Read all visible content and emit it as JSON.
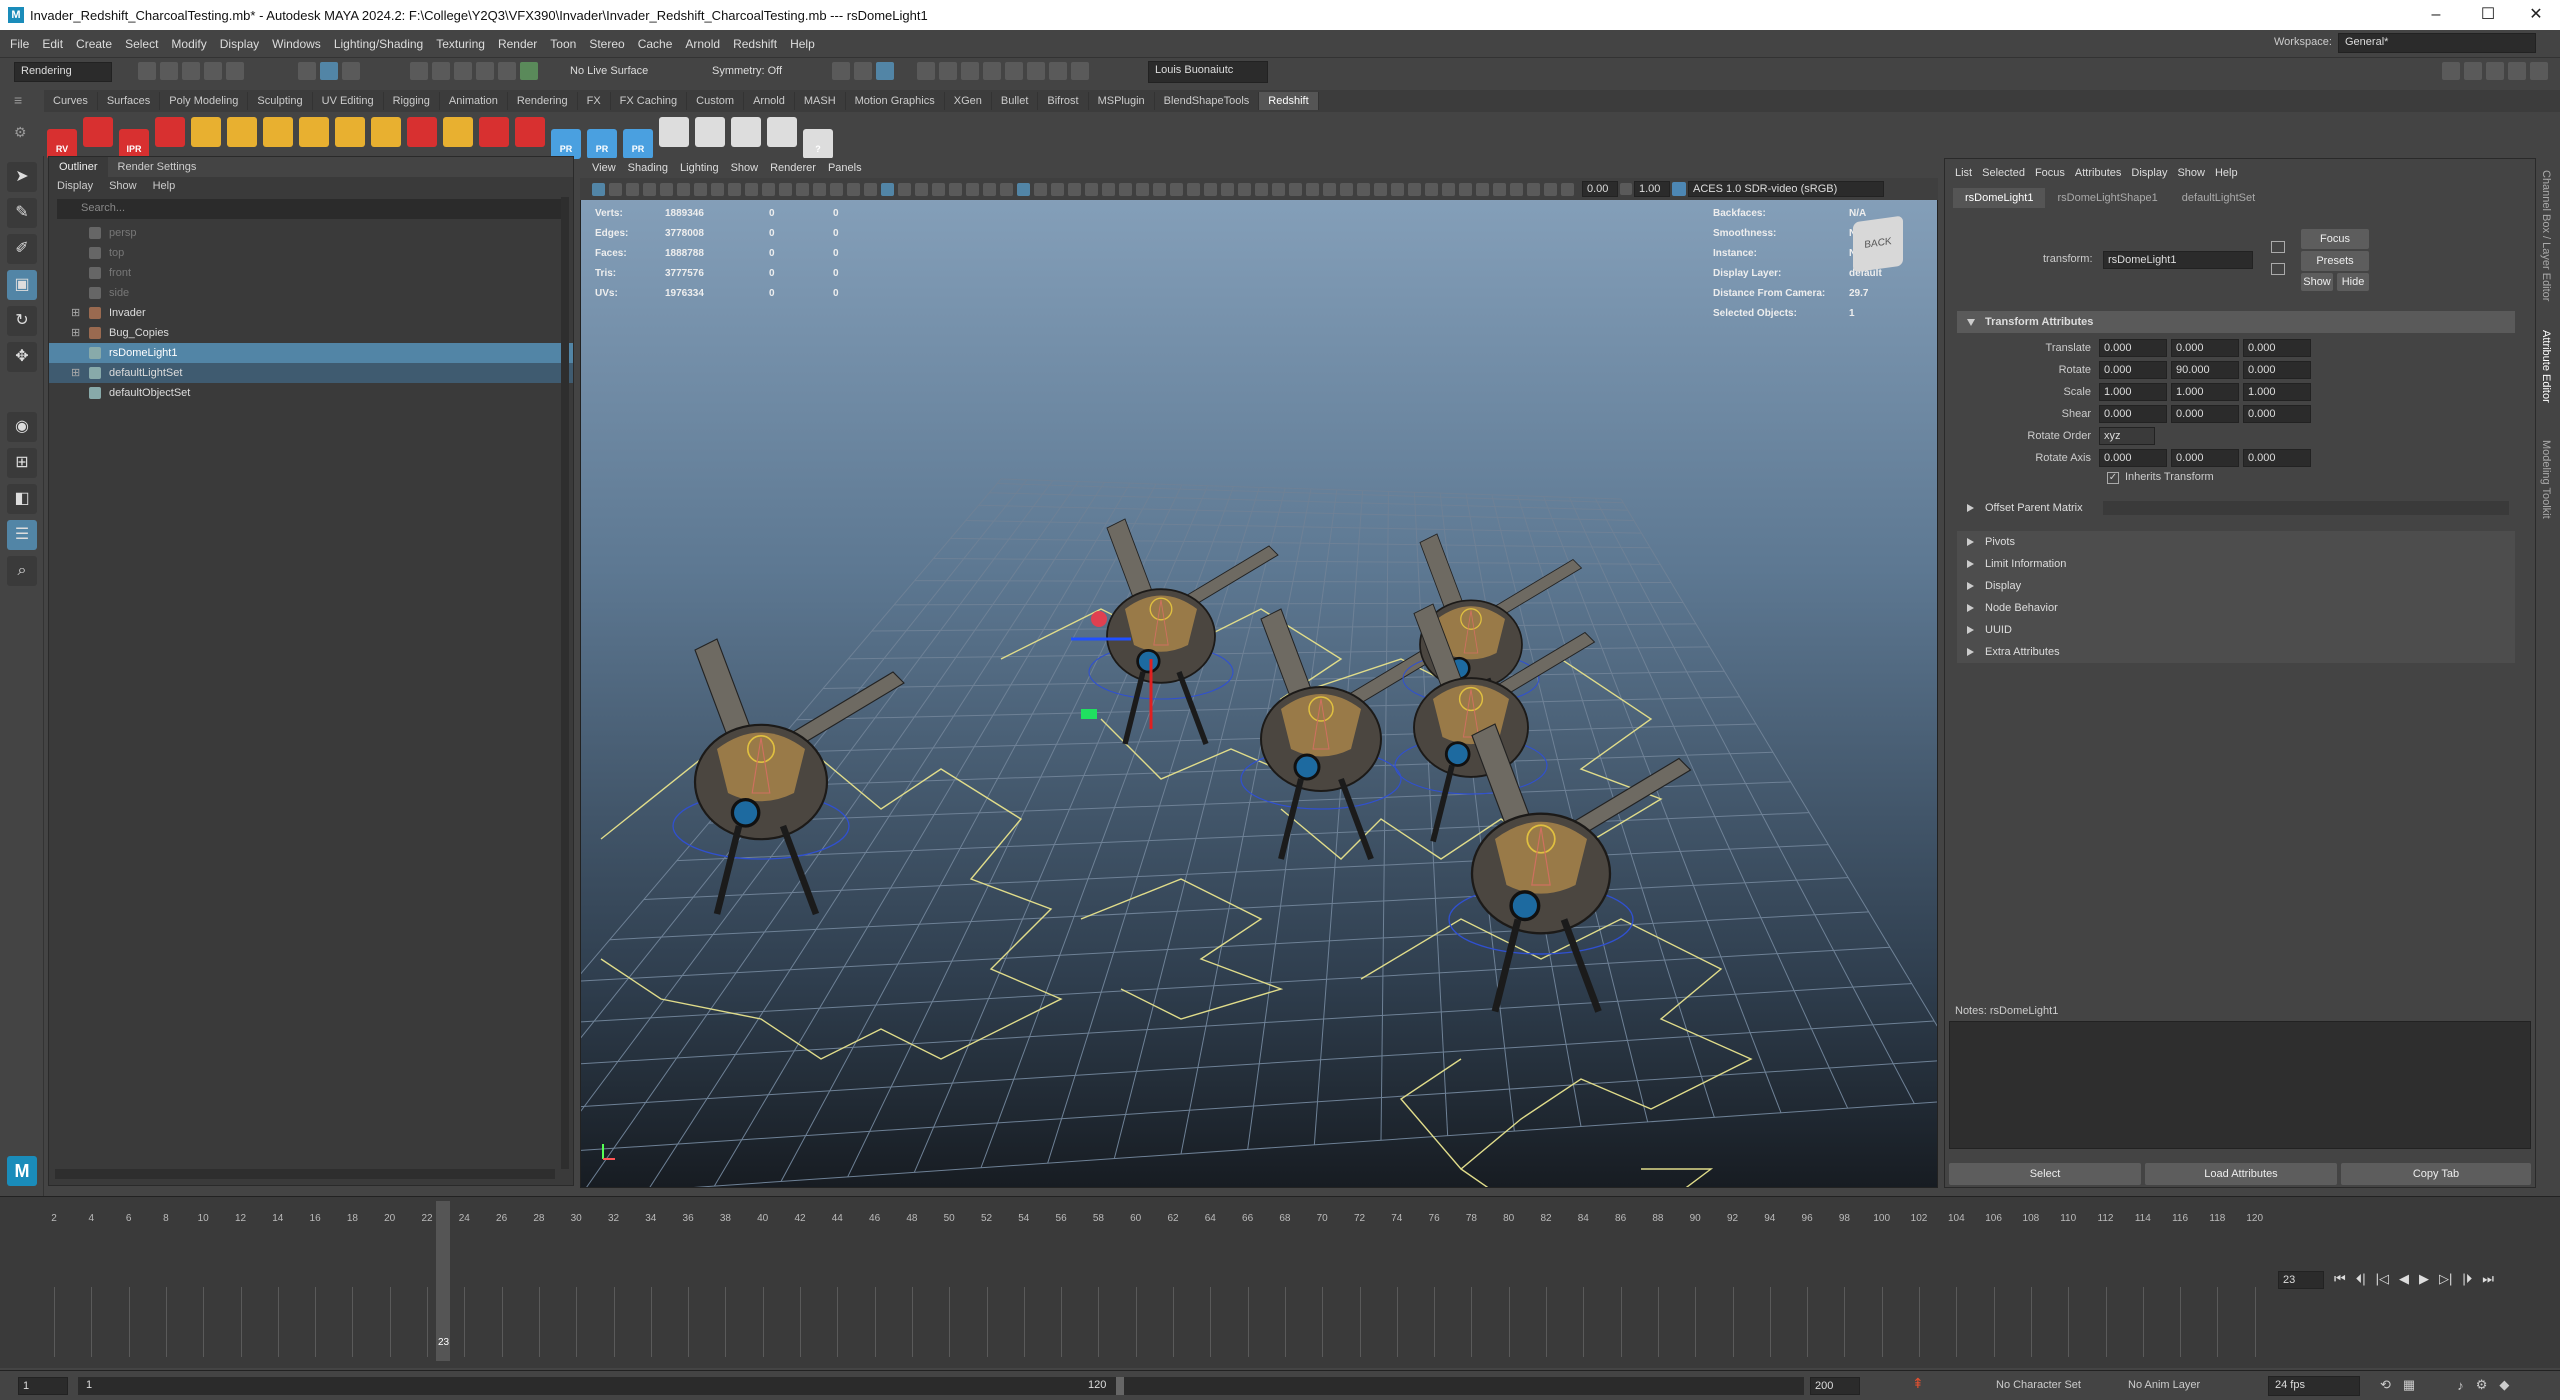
{
  "window": {
    "title": "Invader_Redshift_CharcoalTesting.mb* - Autodesk MAYA 2024.2: F:\\College\\Y2Q3\\VFX390\\Invader\\Invader_Redshift_CharcoalTesting.mb   ---   rsDomeLight1",
    "logo": "M"
  },
  "menubar": {
    "items": [
      "File",
      "Edit",
      "Create",
      "Select",
      "Modify",
      "Display",
      "Windows",
      "Lighting/Shading",
      "Texturing",
      "Render",
      "Toon",
      "Stereo",
      "Cache",
      "Arnold",
      "Redshift",
      "Help"
    ],
    "workspace_label": "Workspace:",
    "workspace_value": "General*"
  },
  "statusline": {
    "menuset": "Rendering",
    "live_surface": "No Live Surface",
    "symmetry": "Symmetry: Off",
    "user": "Louis Buonaiutc"
  },
  "shelf": {
    "tabs": [
      "Curves",
      "Surfaces",
      "Poly Modeling",
      "Sculpting",
      "UV Editing",
      "Rigging",
      "Animation",
      "Rendering",
      "FX",
      "FX Caching",
      "Custom",
      "Arnold",
      "MASH",
      "Motion Graphics",
      "XGen",
      "Bullet",
      "Bifrost",
      "MSPlugin",
      "BlendShapeTools",
      "Redshift"
    ],
    "active_tab": "Redshift",
    "icon_colors": [
      "#d83030",
      "#d83030",
      "#d83030",
      "#d83030",
      "#e8b030",
      "#e8b030",
      "#e8b030",
      "#e8b030",
      "#e8b030",
      "#e8b030",
      "#d83030",
      "#e8b030",
      "#d83030",
      "#d83030",
      "#4aa0e0",
      "#4aa0e0",
      "#4aa0e0",
      "#dddddd",
      "#dddddd",
      "#dddddd",
      "#dddddd",
      "#dddddd"
    ],
    "icon_labels": [
      "RV",
      "",
      "IPR",
      "",
      "",
      "",
      "",
      "",
      "",
      "",
      "",
      "",
      "",
      "",
      "PR",
      "PR",
      "PR",
      "",
      "",
      "",
      "",
      "?"
    ]
  },
  "outliner": {
    "tabs": [
      "Outliner",
      "Render Settings"
    ],
    "menu": [
      "Display",
      "Show",
      "Help"
    ],
    "search_placeholder": "Search...",
    "items": [
      {
        "label": "persp",
        "dim": true
      },
      {
        "label": "top",
        "dim": true
      },
      {
        "label": "front",
        "dim": true
      },
      {
        "label": "side",
        "dim": true
      },
      {
        "label": "Invader",
        "dim": false
      },
      {
        "label": "Bug_Copies",
        "dim": false
      },
      {
        "label": "rsDomeLight1",
        "dim": false
      },
      {
        "label": "defaultLightSet",
        "dim": false
      },
      {
        "label": "defaultObjectSet",
        "dim": false
      }
    ]
  },
  "viewport": {
    "menu": [
      "View",
      "Shading",
      "Lighting",
      "Show",
      "Renderer",
      "Panels"
    ],
    "exposure": "0.00",
    "gamma": "1.00",
    "color_space": "ACES 1.0 SDR-video (sRGB)",
    "hud_left": [
      {
        "label": "Verts:",
        "v1": "1889346",
        "v2": "0",
        "v3": "0"
      },
      {
        "label": "Edges:",
        "v1": "3778008",
        "v2": "0",
        "v3": "0"
      },
      {
        "label": "Faces:",
        "v1": "1888788",
        "v2": "0",
        "v3": "0"
      },
      {
        "label": "Tris:",
        "v1": "3777576",
        "v2": "0",
        "v3": "0"
      },
      {
        "label": "UVs:",
        "v1": "1976334",
        "v2": "0",
        "v3": "0"
      }
    ],
    "hud_right": [
      {
        "label": "Backfaces:",
        "value": "N/A"
      },
      {
        "label": "Smoothness:",
        "value": "N/A"
      },
      {
        "label": "Instance:",
        "value": "No"
      },
      {
        "label": "Display Layer:",
        "value": "default"
      },
      {
        "label": "Distance From Camera:",
        "value": "29.7"
      },
      {
        "label": "Selected Objects:",
        "value": "1"
      }
    ],
    "cube_label": "BACK"
  },
  "attribute_editor": {
    "menu": [
      "List",
      "Selected",
      "Focus",
      "Attributes",
      "Display",
      "Show",
      "Help"
    ],
    "tabs": [
      "rsDomeLight1",
      "rsDomeLightShape1",
      "defaultLightSet"
    ],
    "transform_label": "transform:",
    "transform_value": "rsDomeLight1",
    "buttons": {
      "focus": "Focus",
      "presets": "Presets",
      "show": "Show",
      "hide": "Hide"
    },
    "section_title": "Transform Attributes",
    "translate": {
      "label": "Translate",
      "x": "0.000",
      "y": "0.000",
      "z": "0.000"
    },
    "rotate": {
      "label": "Rotate",
      "x": "0.000",
      "y": "90.000",
      "z": "0.000"
    },
    "scale": {
      "label": "Scale",
      "x": "1.000",
      "y": "1.000",
      "z": "1.000"
    },
    "shear": {
      "label": "Shear",
      "x": "0.000",
      "y": "0.000",
      "z": "0.000"
    },
    "rotate_order": {
      "label": "Rotate Order",
      "value": "xyz"
    },
    "rotate_axis": {
      "label": "Rotate Axis",
      "x": "0.000",
      "y": "0.000",
      "z": "0.000"
    },
    "inherits_label": "Inherits Transform",
    "offset_parent": "Offset Parent Matrix",
    "sections": [
      "Pivots",
      "Limit Information",
      "Display",
      "Node Behavior",
      "UUID",
      "Extra Attributes"
    ],
    "notes_label": "Notes:  rsDomeLight1",
    "bottom_buttons": [
      "Select",
      "Load Attributes",
      "Copy Tab"
    ],
    "side_tabs": [
      "Channel Box / Layer Editor",
      "Attribute Editor",
      "Modeling Toolkit"
    ]
  },
  "timeline": {
    "ticks": [
      "2",
      "4",
      "6",
      "8",
      "10",
      "12",
      "14",
      "16",
      "18",
      "20",
      "22",
      "24",
      "26",
      "28",
      "30",
      "32",
      "34",
      "36",
      "38",
      "40",
      "42",
      "44",
      "46",
      "48",
      "50",
      "52",
      "54",
      "56",
      "58",
      "60",
      "62",
      "64",
      "66",
      "68",
      "70",
      "72",
      "74",
      "76",
      "78",
      "80",
      "82",
      "84",
      "86",
      "88",
      "90",
      "92",
      "94",
      "96",
      "98",
      "100",
      "102",
      "104",
      "106",
      "108",
      "110",
      "112",
      "114",
      "116",
      "118",
      "120"
    ],
    "current_frame": "23",
    "current_frame_field": "23"
  },
  "range": {
    "start": "1",
    "range_start": "1",
    "range_end": "120",
    "end": "200",
    "character_set": "No Character Set",
    "anim_layer": "No Anim Layer",
    "fps": "24 fps"
  }
}
